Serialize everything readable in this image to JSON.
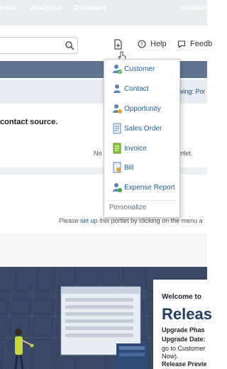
{
  "header": {
    "help_label": "Help",
    "feedback_label": "Feedb"
  },
  "nav": {
    "items": [
      "ports",
      "Analytics",
      "Documen",
      "nization"
    ]
  },
  "strip": {
    "text": "wing: Por"
  },
  "portlet1": {
    "text": "contact source.",
    "tail_prefix": "No",
    "tail_suffix": "rtlet."
  },
  "portlet2": {
    "setup_prefix": "Please",
    "setup_link": "set up",
    "setup_suffix": "this portlet by clicking on the menu a"
  },
  "banner": {
    "welcome": "Welcome to",
    "big": "Releas",
    "line1": "Upgrade Phas",
    "line2": "Upgrade Date:",
    "line3": "go to Customer",
    "line4": "Now).",
    "line5": "Release Previe"
  },
  "create_menu": {
    "items": [
      "Customer",
      "Contact",
      "Opportunity",
      "Sales Order",
      "Invoice",
      "Bill",
      "Expense Report"
    ],
    "personalize": "Personalize"
  },
  "colors": {
    "nav_bg": "#5f7591",
    "link": "#1f5d93",
    "banner_bg": "#364864"
  }
}
